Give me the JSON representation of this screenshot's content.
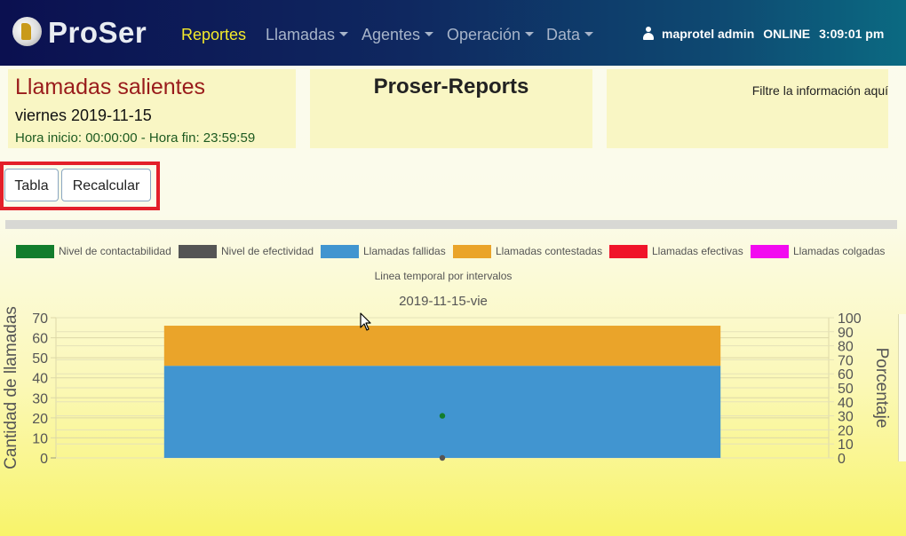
{
  "navbar": {
    "brand": "ProSer",
    "items": [
      {
        "label": "Reportes",
        "active": true,
        "dropdown": false
      },
      {
        "label": "Llamadas",
        "active": false,
        "dropdown": true
      },
      {
        "label": "Agentes",
        "active": false,
        "dropdown": true
      },
      {
        "label": "Operación",
        "active": false,
        "dropdown": true
      },
      {
        "label": "Data",
        "active": false,
        "dropdown": true
      }
    ],
    "user": "maprotel admin",
    "status": "ONLINE",
    "time": "3:09:01 pm"
  },
  "header": {
    "report_title": "Llamadas salientes",
    "date": "viernes 2019-11-15",
    "hours": "Hora inicio: 00:00:00 - Hora fin: 23:59:59",
    "app_title": "Proser-Reports",
    "filter_hint": "Filtre la información aquí"
  },
  "buttons": {
    "tabla": "Tabla",
    "recalcular": "Recalcular"
  },
  "chart_data": {
    "type": "bar",
    "title": "Linea temporal por intervalos",
    "subtitle": "2019-11-15-vie",
    "categories": [
      "2019-11-15-vie"
    ],
    "ylabel": "Cantidad de llamadas",
    "y2label": "Porcentaje",
    "ylim": [
      0,
      70
    ],
    "y2lim": [
      0,
      100
    ],
    "yticks": [
      0,
      10,
      20,
      30,
      40,
      50,
      60,
      70
    ],
    "y2ticks": [
      0,
      10,
      20,
      30,
      40,
      50,
      60,
      70,
      80,
      90,
      100
    ],
    "legend_position": "top",
    "series": [
      {
        "name": "Nivel de contactabilidad",
        "kind": "point",
        "axis": "y2",
        "color": "#127d2c",
        "values": [
          30
        ]
      },
      {
        "name": "Nivel de efectividad",
        "kind": "point",
        "axis": "y2",
        "color": "#555555",
        "values": [
          0
        ]
      },
      {
        "name": "Llamadas fallidas",
        "kind": "stacked-bar",
        "axis": "y",
        "color": "#4195d0",
        "values": [
          46
        ]
      },
      {
        "name": "Llamadas contestadas",
        "kind": "stacked-bar",
        "axis": "y",
        "color": "#eaa42a",
        "values": [
          20
        ]
      },
      {
        "name": "Llamadas efectivas",
        "kind": "stacked-bar",
        "axis": "y",
        "color": "#f0142a",
        "values": [
          0
        ]
      },
      {
        "name": "Llamadas colgadas",
        "kind": "stacked-bar",
        "axis": "y",
        "color": "#f20af0",
        "values": [
          0
        ]
      }
    ]
  }
}
